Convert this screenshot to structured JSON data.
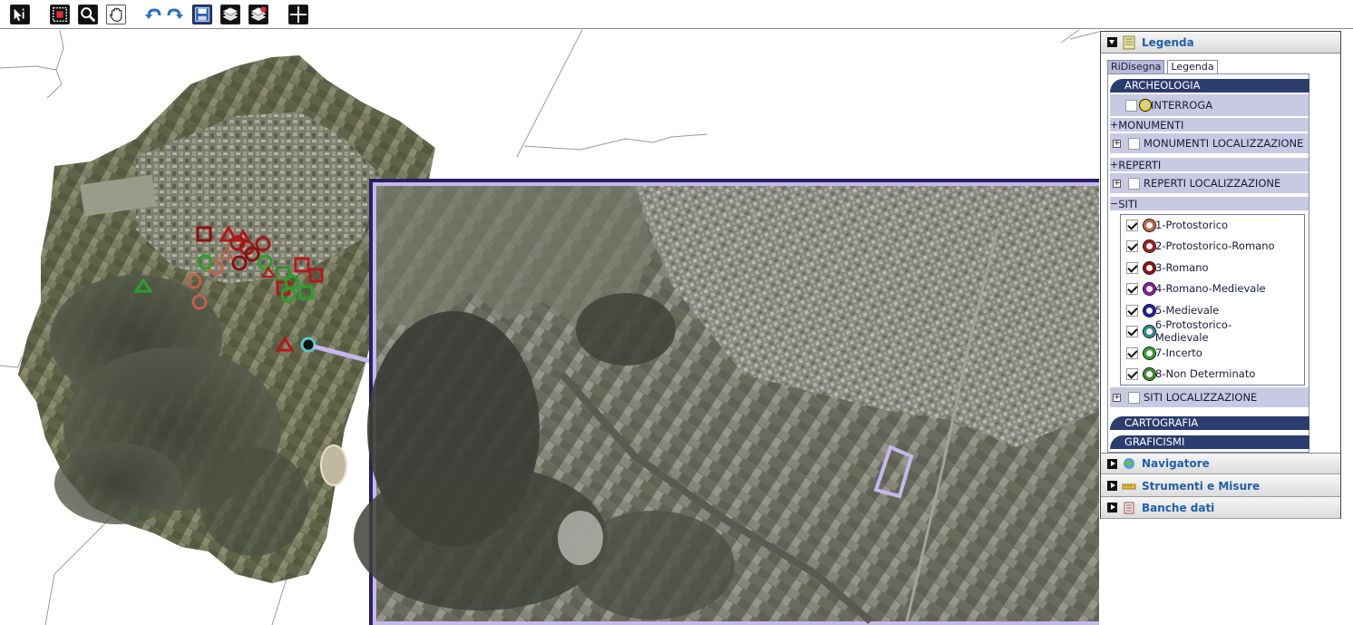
{
  "toolbar": {
    "tools": [
      {
        "name": "select-tool-button"
      },
      {
        "name": "zoom-box-button"
      },
      {
        "name": "zoom-button"
      },
      {
        "name": "pan-button"
      },
      {
        "name": "undo-button"
      },
      {
        "name": "redo-button"
      },
      {
        "name": "save-button"
      },
      {
        "name": "layers-button"
      },
      {
        "name": "layers-alt-button"
      },
      {
        "name": "full-extent-button"
      }
    ]
  },
  "panel": {
    "legenda_title": "Legenda",
    "tabs": [
      "RiDisegna",
      "Legenda"
    ],
    "categories": {
      "archeologia": "ARCHEOLOGIA",
      "cartografia": "CARTOGRAFIA",
      "graficismi": "GRAFICISMI"
    },
    "archeologia": {
      "interroga": "INTERROGA",
      "monumenti": "MONUMENTI",
      "monumenti_loc": "MONUMENTI LOCALIZZAZIONE",
      "reperti": "REPERTI",
      "reperti_loc": "REPERTI LOCALIZZAZIONE",
      "siti": "SITI",
      "siti_loc": "SITI LOCALIZZAZIONE",
      "siti_items": [
        {
          "label": "1-Protostorico",
          "color": "#c0604a",
          "checked": true
        },
        {
          "label": "2-Protostorico-Romano",
          "color": "#a01818",
          "checked": true
        },
        {
          "label": "3-Romano",
          "color": "#8a1010",
          "checked": true
        },
        {
          "label": "4-Romano-Medievale",
          "color": "#8a1a9a",
          "checked": true
        },
        {
          "label": "5-Medievale",
          "color": "#1a1aa0",
          "checked": true
        },
        {
          "label": "6-Protostorico-Medievale",
          "color": "#2a8a8a",
          "checked": true
        },
        {
          "label": "7-Incerto",
          "color": "#2aa02a",
          "checked": true
        },
        {
          "label": "8-Non Determinato",
          "color": "#3a8a2a",
          "checked": true
        }
      ]
    },
    "sections": {
      "navigatore": "Navigatore",
      "strumenti": "Strumenti e Misure",
      "banche": "Banche dati"
    }
  },
  "colors": {
    "accent": "#1f5fa8",
    "category_bg": "#2b3d6e",
    "row_bg": "#c9c9e3",
    "inset_frame": "#2a1e66",
    "inset_border": "#c6b8ee",
    "connector": "#c6b8ee"
  }
}
